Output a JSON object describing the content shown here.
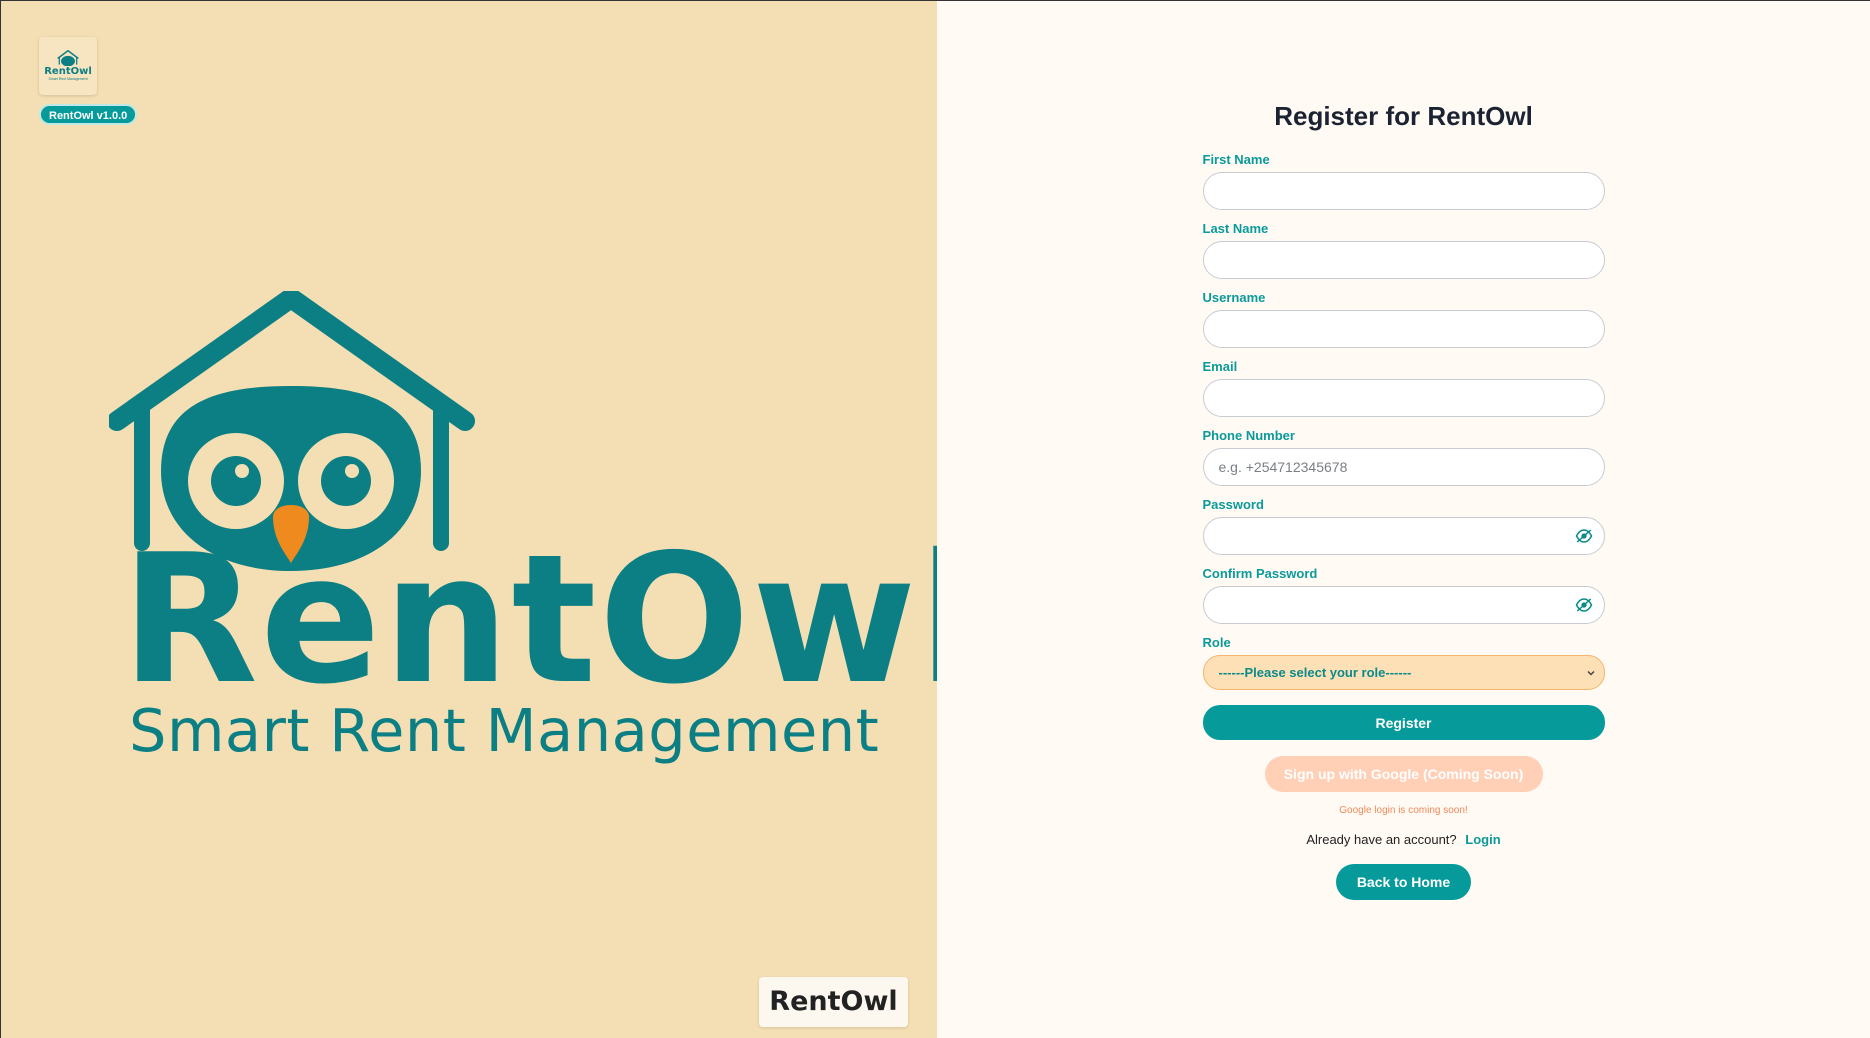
{
  "brand": {
    "small_logo_text": "RentOwl",
    "small_logo_sub": "Smart Rent Management",
    "version": "RentOwl v1.0.0",
    "logo_word": "RentOwl",
    "tagline": "Smart Rent Management",
    "corner_label": "RentOwl",
    "colors": {
      "teal": "#0b7f83",
      "beak": "#ef8a1e",
      "panel": "#f4dfb4"
    }
  },
  "form": {
    "title": "Register for RentOwl",
    "fields": {
      "first_name": {
        "label": "First Name",
        "value": "",
        "placeholder": ""
      },
      "last_name": {
        "label": "Last Name",
        "value": "",
        "placeholder": ""
      },
      "username": {
        "label": "Username",
        "value": "",
        "placeholder": ""
      },
      "email": {
        "label": "Email",
        "value": "",
        "placeholder": ""
      },
      "phone": {
        "label": "Phone Number",
        "value": "",
        "placeholder": "e.g. +254712345678"
      },
      "password": {
        "label": "Password",
        "value": "",
        "placeholder": ""
      },
      "confirm_password": {
        "label": "Confirm Password",
        "value": "",
        "placeholder": ""
      }
    },
    "role": {
      "label": "Role",
      "selected": "------Please select your role------"
    },
    "register_label": "Register",
    "google_label": "Sign up with Google (Coming Soon)",
    "google_note": "Google login is coming soon!",
    "login_prompt": "Already have an account?",
    "login_link": "Login",
    "back_home_label": "Back to Home"
  },
  "icons": {
    "password_toggle": "eye-icon",
    "confirm_toggle": "eye-icon",
    "role_dropdown": "chevron-down-icon"
  }
}
